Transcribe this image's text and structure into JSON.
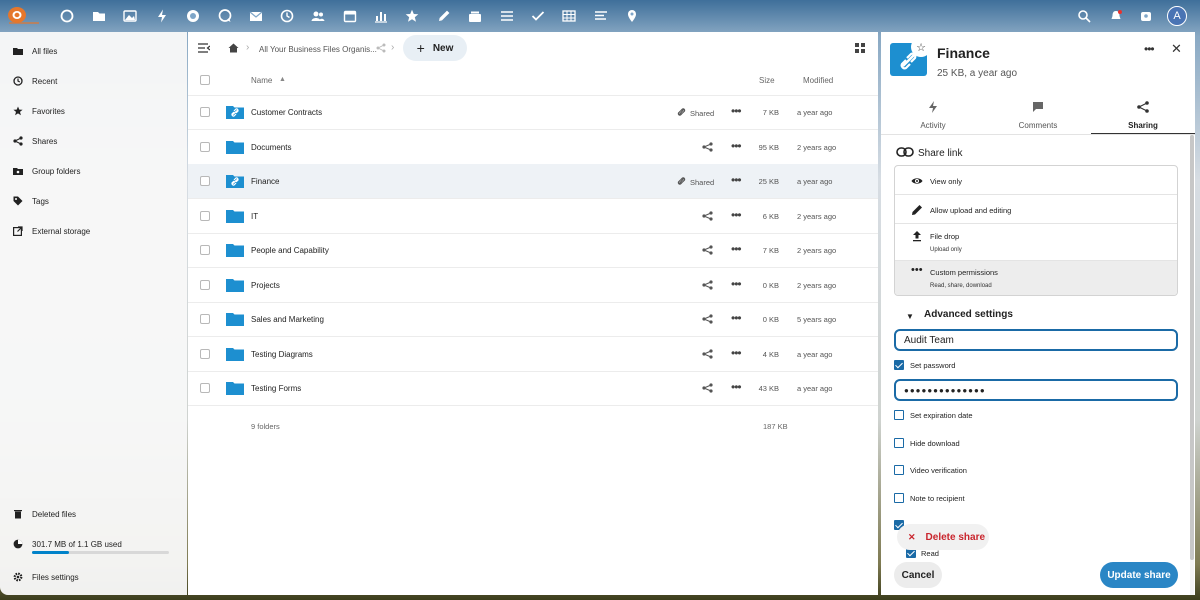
{
  "header": {
    "logo_name": "nextcloud-cloud-logo",
    "apps": [
      "dashboard-icon",
      "files-icon",
      "photos-icon",
      "activity-icon",
      "talk-icon",
      "chat-icon",
      "mail-icon",
      "clock-icon",
      "contacts-icon",
      "calendar-icon",
      "analytics-icon",
      "star-icon",
      "notes-icon",
      "deck-icon",
      "list-icon",
      "tasks-icon",
      "tables-icon",
      "forms-icon",
      "maps-icon"
    ],
    "right_icons": [
      "search-icon",
      "notifications-icon",
      "contacts-menu-icon"
    ],
    "avatar_letter": "A"
  },
  "nav": {
    "items": [
      {
        "label": "All files",
        "icon": "folder-icon"
      },
      {
        "label": "Recent",
        "icon": "clock-icon"
      },
      {
        "label": "Favorites",
        "icon": "star-icon"
      },
      {
        "label": "Shares",
        "icon": "share-icon"
      },
      {
        "label": "Group folders",
        "icon": "group-folder-icon"
      },
      {
        "label": "Tags",
        "icon": "tag-icon"
      },
      {
        "label": "External storage",
        "icon": "external-storage-icon"
      }
    ],
    "deleted_files": "Deleted files",
    "quota_text": "301.7 MB of 1.1 GB used",
    "quota_fraction": 0.27,
    "settings": "Files settings"
  },
  "files": {
    "breadcrumb": "All Your Business Files Organis...",
    "new_label": "New",
    "columns": {
      "name": "Name",
      "size": "Size",
      "modified": "Modified"
    },
    "rows": [
      {
        "name": "Customer Contracts",
        "shared": "Shared",
        "size": "7 KB",
        "modified": "a year ago"
      },
      {
        "name": "Documents",
        "shared": "",
        "size": "95 KB",
        "modified": "2 years ago"
      },
      {
        "name": "Finance",
        "shared": "Shared",
        "size": "25 KB",
        "modified": "a year ago"
      },
      {
        "name": "IT",
        "shared": "",
        "size": "6 KB",
        "modified": "2 years ago"
      },
      {
        "name": "People and Capability",
        "shared": "",
        "size": "7 KB",
        "modified": "2 years ago"
      },
      {
        "name": "Projects",
        "shared": "",
        "size": "0 KB",
        "modified": "2 years ago"
      },
      {
        "name": "Sales and Marketing",
        "shared": "",
        "size": "0 KB",
        "modified": "5 years ago"
      },
      {
        "name": "Testing Diagrams",
        "shared": "",
        "size": "4 KB",
        "modified": "a year ago"
      },
      {
        "name": "Testing Forms",
        "shared": "",
        "size": "43 KB",
        "modified": "a year ago"
      }
    ],
    "summary_count": "9 folders",
    "summary_size": "187 KB"
  },
  "sidebar": {
    "title": "Finance",
    "subtitle": "25 KB, a year ago",
    "tabs": [
      {
        "label": "Activity",
        "icon": "activity-icon"
      },
      {
        "label": "Comments",
        "icon": "comment-icon"
      },
      {
        "label": "Sharing",
        "icon": "share-icon"
      }
    ],
    "share_link_label": "Share link",
    "permissions": [
      {
        "label": "View only",
        "sub": "",
        "icon": "eye-icon"
      },
      {
        "label": "Allow upload and editing",
        "sub": "",
        "icon": "pencil-icon"
      },
      {
        "label": "File drop",
        "sub": "Upload only",
        "icon": "upload-icon"
      },
      {
        "label": "Custom permissions",
        "sub": "Read, share, download",
        "icon": "dots-icon"
      }
    ],
    "advanced_label": "Advanced settings",
    "label_value": "Audit Team",
    "set_password": "Set password",
    "password_value": "●●●●●●●●●●●●●●",
    "set_expiration": "Set expiration date",
    "hide_download": "Hide download",
    "video_verification": "Video verification",
    "note_to_recipient": "Note to recipient",
    "delete_label": "Delete share",
    "read_label": "Read",
    "cancel_label": "Cancel",
    "update_label": "Update share",
    "accent_color": "#2a86c5",
    "danger_color": "#c9252d"
  }
}
